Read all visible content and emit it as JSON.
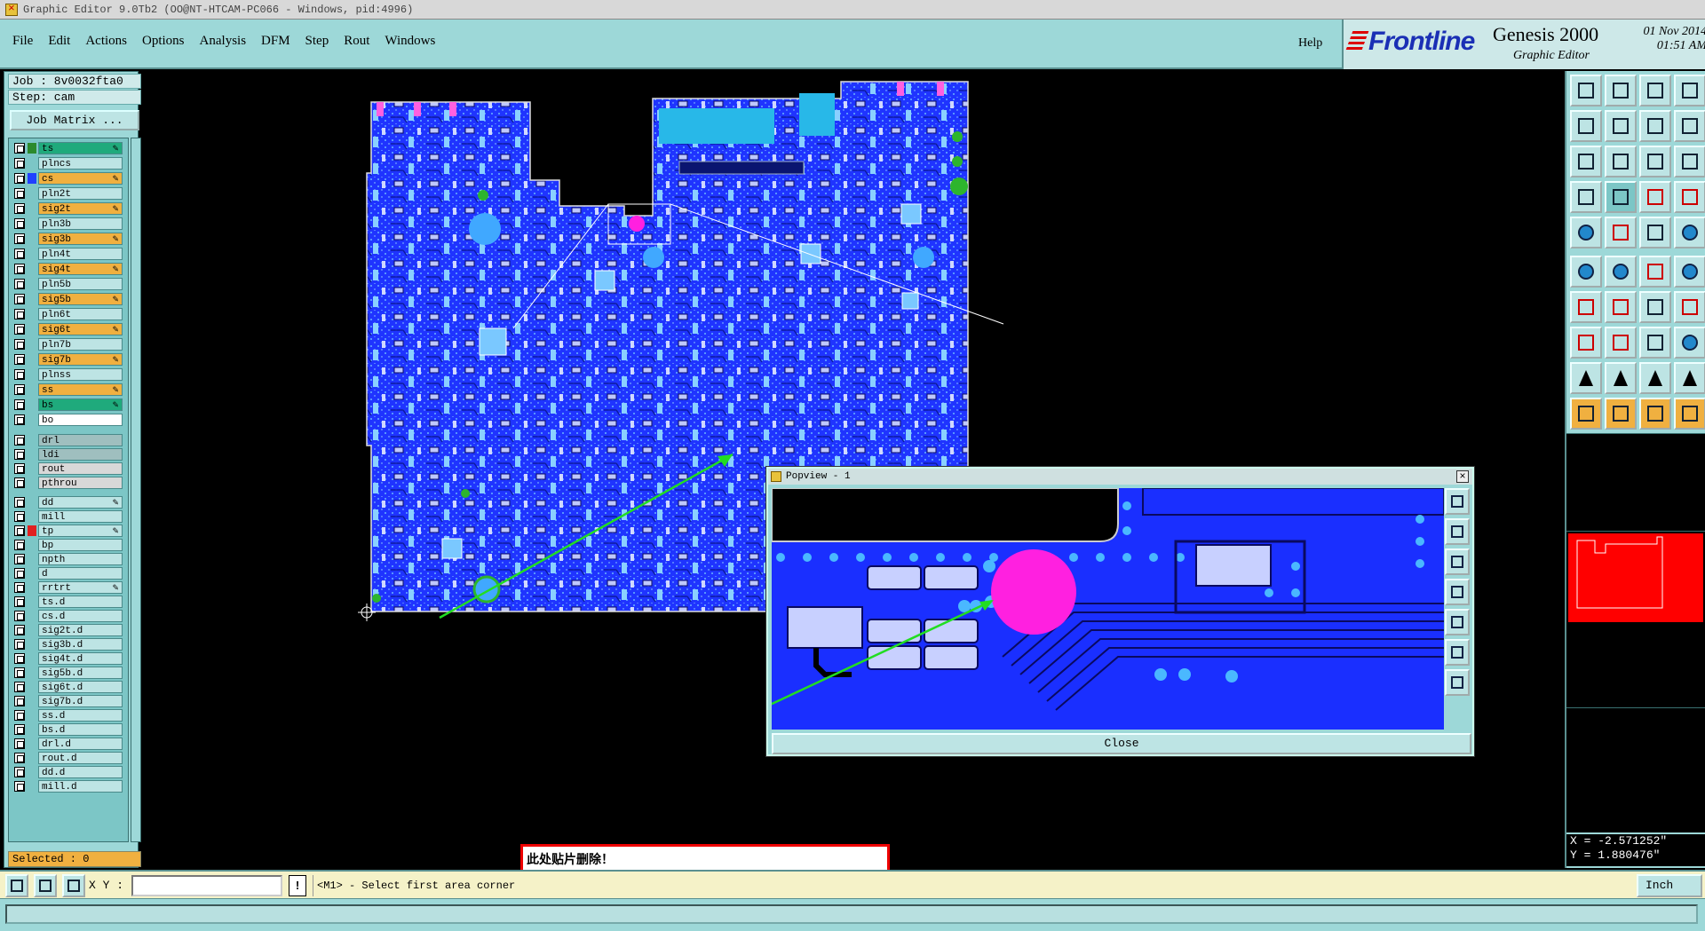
{
  "window": {
    "title": "Graphic Editor 9.0Tb2 (OO@NT-HTCAM-PC066 - Windows, pid:4996)"
  },
  "menu": {
    "items": [
      "File",
      "Edit",
      "Actions",
      "Options",
      "Analysis",
      "DFM",
      "Step",
      "Rout",
      "Windows"
    ],
    "help": "Help"
  },
  "brand": {
    "company": "Frontline",
    "product": "Genesis 2000",
    "subtitle": "Graphic Editor",
    "date": "01 Nov 2014",
    "time": "01:51 AM"
  },
  "job": {
    "job_label": "Job : 8v0032fta0",
    "step_label": "Step: cam",
    "matrix_button": "Job Matrix ..."
  },
  "layers": [
    {
      "name": "ts",
      "color": "#1faa7c",
      "swatch": "#2c8a2c",
      "pen": true
    },
    {
      "name": "plncs",
      "color": "#bde4e4",
      "swatch": "",
      "pen": false
    },
    {
      "name": "cs",
      "color": "#f0b040",
      "swatch": "#2040ff",
      "pen": true
    },
    {
      "name": "pln2t",
      "color": "#bde4e4",
      "swatch": "",
      "pen": false
    },
    {
      "name": "sig2t",
      "color": "#f0b040",
      "swatch": "",
      "pen": true
    },
    {
      "name": "pln3b",
      "color": "#bde4e4",
      "swatch": "",
      "pen": false
    },
    {
      "name": "sig3b",
      "color": "#f0b040",
      "swatch": "",
      "pen": true
    },
    {
      "name": "pln4t",
      "color": "#bde4e4",
      "swatch": "",
      "pen": false
    },
    {
      "name": "sig4t",
      "color": "#f0b040",
      "swatch": "",
      "pen": true
    },
    {
      "name": "pln5b",
      "color": "#bde4e4",
      "swatch": "",
      "pen": false
    },
    {
      "name": "sig5b",
      "color": "#f0b040",
      "swatch": "",
      "pen": true
    },
    {
      "name": "pln6t",
      "color": "#bde4e4",
      "swatch": "",
      "pen": false
    },
    {
      "name": "sig6t",
      "color": "#f0b040",
      "swatch": "",
      "pen": true
    },
    {
      "name": "pln7b",
      "color": "#bde4e4",
      "swatch": "",
      "pen": false
    },
    {
      "name": "sig7b",
      "color": "#f0b040",
      "swatch": "",
      "pen": true
    },
    {
      "name": "plnss",
      "color": "#bde4e4",
      "swatch": "",
      "pen": false
    },
    {
      "name": "ss",
      "color": "#f0b040",
      "swatch": "",
      "pen": true
    },
    {
      "name": "bs",
      "color": "#1faa7c",
      "swatch": "",
      "pen": true
    },
    {
      "name": "bo",
      "color": "#ffffff",
      "swatch": "",
      "pen": false
    },
    {
      "name": "drl",
      "color": "#9fbfbf",
      "swatch": "",
      "pen": false
    },
    {
      "name": "ldi",
      "color": "#9fbfbf",
      "swatch": "",
      "pen": false
    },
    {
      "name": "rout",
      "color": "#d8d8d8",
      "swatch": "",
      "pen": false
    },
    {
      "name": "pthrou",
      "color": "#d8d8d8",
      "swatch": "",
      "pen": false
    },
    {
      "name": "dd",
      "color": "#bde4e4",
      "swatch": "",
      "pen": true
    },
    {
      "name": "mill",
      "color": "#bde4e4",
      "swatch": "",
      "pen": false
    },
    {
      "name": "tp",
      "color": "#bde4e4",
      "swatch": "#e02020",
      "pen": true
    },
    {
      "name": "bp",
      "color": "#bde4e4",
      "swatch": "",
      "pen": false
    },
    {
      "name": "npth",
      "color": "#bde4e4",
      "swatch": "",
      "pen": false
    },
    {
      "name": "d",
      "color": "#bde4e4",
      "swatch": "",
      "pen": false
    },
    {
      "name": "rrtrt",
      "color": "#bde4e4",
      "swatch": "",
      "pen": true
    },
    {
      "name": "ts.d",
      "color": "#bde4e4",
      "swatch": "",
      "pen": false
    },
    {
      "name": "cs.d",
      "color": "#bde4e4",
      "swatch": "",
      "pen": false
    },
    {
      "name": "sig2t.d",
      "color": "#bde4e4",
      "swatch": "",
      "pen": false
    },
    {
      "name": "sig3b.d",
      "color": "#bde4e4",
      "swatch": "",
      "pen": false
    },
    {
      "name": "sig4t.d",
      "color": "#bde4e4",
      "swatch": "",
      "pen": false
    },
    {
      "name": "sig5b.d",
      "color": "#bde4e4",
      "swatch": "",
      "pen": false
    },
    {
      "name": "sig6t.d",
      "color": "#bde4e4",
      "swatch": "",
      "pen": false
    },
    {
      "name": "sig7b.d",
      "color": "#bde4e4",
      "swatch": "",
      "pen": false
    },
    {
      "name": "ss.d",
      "color": "#bde4e4",
      "swatch": "",
      "pen": false
    },
    {
      "name": "bs.d",
      "color": "#bde4e4",
      "swatch": "",
      "pen": false
    },
    {
      "name": "drl.d",
      "color": "#bde4e4",
      "swatch": "",
      "pen": false
    },
    {
      "name": "rout.d",
      "color": "#bde4e4",
      "swatch": "",
      "pen": false
    },
    {
      "name": "dd.d",
      "color": "#bde4e4",
      "swatch": "",
      "pen": false
    },
    {
      "name": "mill.d",
      "color": "#bde4e4",
      "swatch": "",
      "pen": false
    }
  ],
  "selected_label": "Selected : 0",
  "popview": {
    "title": "Popview - 1",
    "close_glyph": "×",
    "close_button": "Close"
  },
  "annotation": {
    "text": "此处贴片删除！"
  },
  "coords": {
    "x": "X = -2.571252\"",
    "y": "Y = 1.880476\""
  },
  "bottom": {
    "xy_label": "X Y :",
    "xy_value": "",
    "warn_glyph": "!",
    "prompt": "<M1> - Select first area corner",
    "unit": "Inch"
  },
  "colors": {
    "panel": "#9dd8d8",
    "board": "#1a2fff",
    "highlight": "#ff20e0",
    "annotation_border": "#e00000",
    "arrow": "#22dd22"
  },
  "icons": {
    "right_tools": [
      "layer-up-icon",
      "layer-down-icon",
      "home-icon",
      "window-icon",
      "zoom-left-icon",
      "zoom-right-icon",
      "undo-zoom-icon",
      "zoom-sel-icon",
      "fit-icon",
      "pan-icon",
      "one-to-one-icon",
      "help-icon",
      "snap-icon",
      "grid-icon",
      "measure-icon",
      "feature-icon",
      "pad-icon",
      "line-icon",
      "surface-icon",
      "circle-icon",
      "connect-icon",
      "cross-icon",
      "segment-icon",
      "node-icon",
      "angle-icon",
      "slash-icon",
      "arc-icon",
      "ruler-icon",
      "add-icon",
      "minus-icon",
      "bracket-icon",
      "copy-icon",
      "triangle-a-icon",
      "triangle-b-icon",
      "triangle-c-icon",
      "triangle-d-icon",
      "cursor-icon",
      "cursor-select-icon",
      "cursor-area-icon",
      "cursor-path-icon"
    ]
  }
}
